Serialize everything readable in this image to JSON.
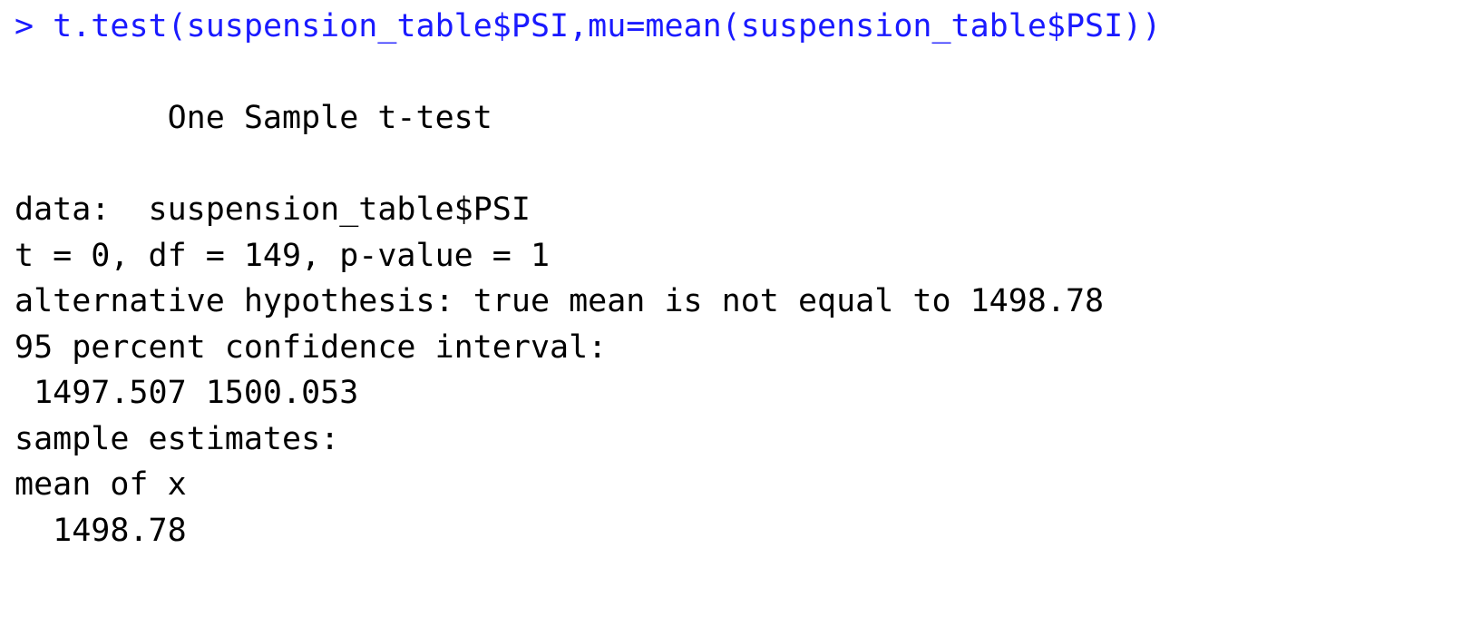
{
  "console": {
    "prompt": "> ",
    "command": "t.test(suspension_table$PSI,mu=mean(suspension_table$PSI))",
    "output": [
      "",
      "        One Sample t-test",
      "",
      "data:  suspension_table$PSI",
      "t = 0, df = 149, p-value = 1",
      "alternative hypothesis: true mean is not equal to 1498.78",
      "95 percent confidence interval:",
      " 1497.507 1500.053",
      "sample estimates:",
      "mean of x",
      "  1498.78"
    ]
  },
  "colors": {
    "command": "#1a1aff",
    "output": "#000000",
    "background": "#ffffff"
  }
}
